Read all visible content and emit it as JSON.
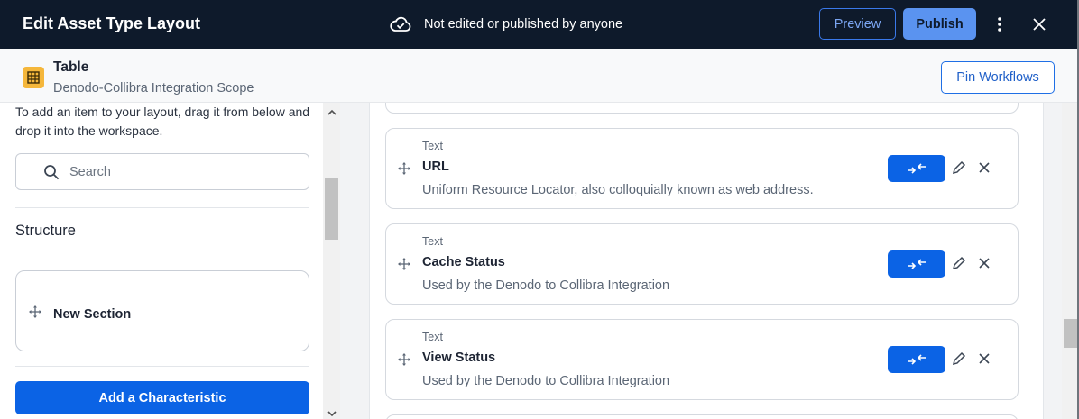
{
  "header": {
    "title": "Edit Asset Type Layout",
    "status": "Not edited or published by anyone",
    "preview_label": "Preview",
    "publish_label": "Publish"
  },
  "asset": {
    "name": "Table",
    "scope": "Denodo-Collibra Integration Scope",
    "icon": "table-grid-icon",
    "icon_color": "#f5b73b"
  },
  "pin_workflows_label": "Pin Workflows",
  "sidebar": {
    "hint": "To add an item to your layout, drag it from below and drop it into the workspace.",
    "search_placeholder": "Search",
    "structure_heading": "Structure",
    "new_section_label": "New Section",
    "add_characteristic_label": "Add a Characteristic"
  },
  "workspace": {
    "cards": [
      {
        "kind": "Text",
        "name": "URL",
        "description": "Uniform Resource Locator, also colloquially known as web address."
      },
      {
        "kind": "Text",
        "name": "Cache Status",
        "description": "Used by the Denodo to Collibra Integration"
      },
      {
        "kind": "Text",
        "name": "View Status",
        "description": "Used by the Denodo to Collibra Integration"
      }
    ]
  },
  "colors": {
    "topbar": "#0e1a2b",
    "primary": "#0b63e5",
    "publish": "#5a93f0"
  }
}
